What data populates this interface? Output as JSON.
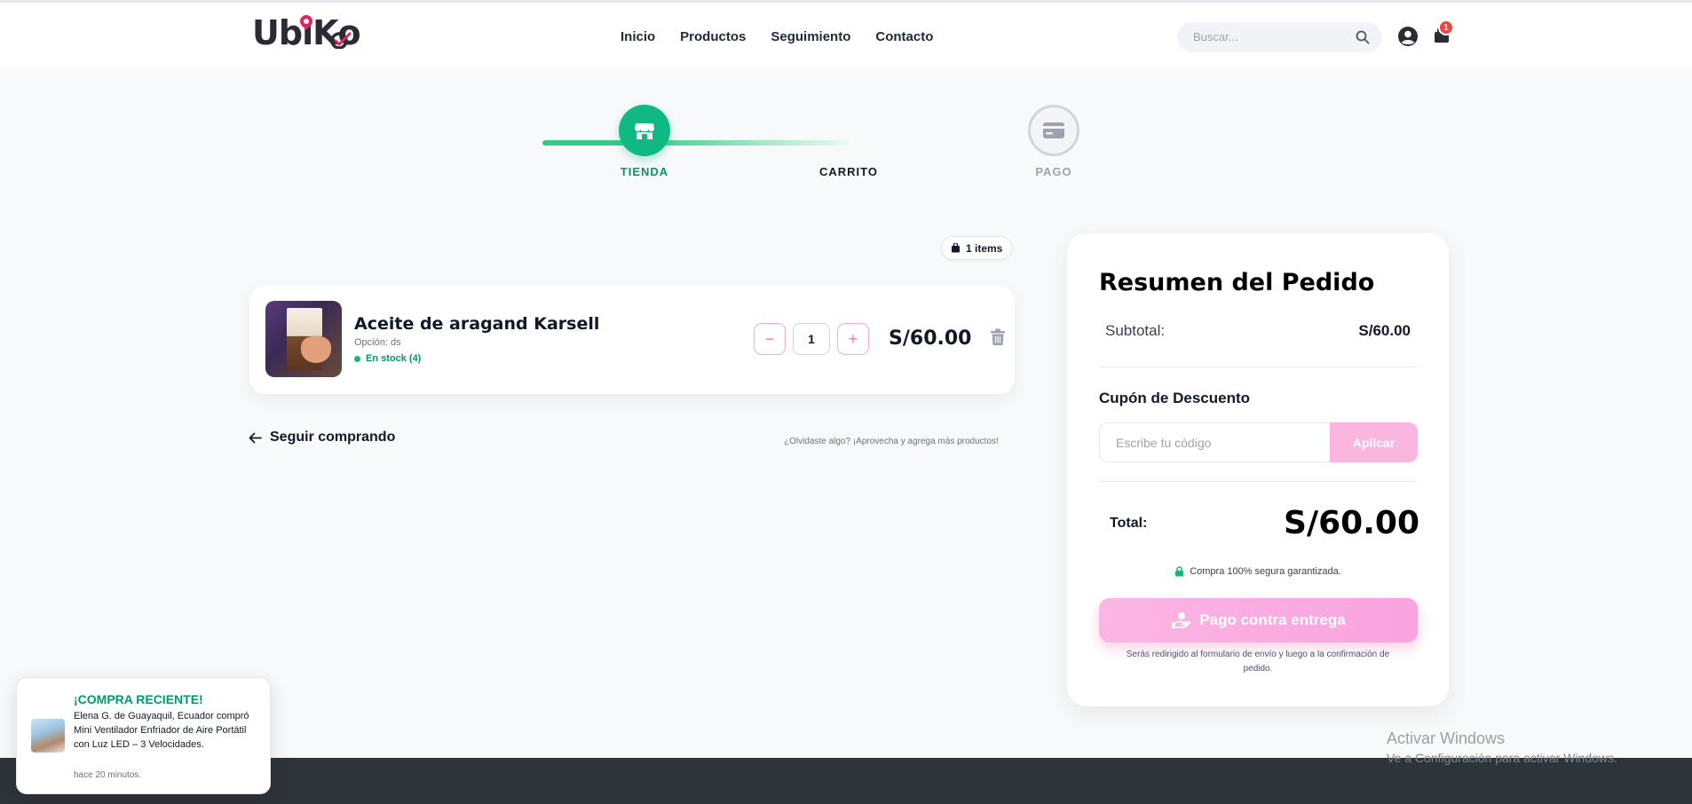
{
  "brand": {
    "logo_text_a": "Ub",
    "logo_text_b": "iK",
    "logo_text_c": "o"
  },
  "nav": {
    "items": [
      {
        "label": "Inicio"
      },
      {
        "label": "Productos"
      },
      {
        "label": "Seguimiento"
      },
      {
        "label": "Contacto"
      }
    ]
  },
  "search": {
    "placeholder": "Buscar..."
  },
  "cart": {
    "badge": "1"
  },
  "steps": [
    {
      "label": "TIENDA",
      "state": "done"
    },
    {
      "label": "CARRITO",
      "state": "current"
    },
    {
      "label": "PAGO",
      "state": "pending"
    }
  ],
  "items_badge": "1 items",
  "product": {
    "name": "Aceite de aragand Karsell",
    "option": "Opción: ds",
    "stock": "En stock (4)",
    "quantity": "1",
    "minus": "−",
    "plus": "+",
    "price": "S/60.00"
  },
  "continue_label": "Seguir comprando",
  "forgot_text": "¿Olvidaste algo? ¡Aprovecha y agrega más productos!",
  "summary": {
    "title": "Resumen del Pedido",
    "subtotal_label": "Subtotal:",
    "subtotal_value": "S/60.00",
    "coupon_title": "Cupón de Descuento",
    "coupon_placeholder": "Escribe tu código",
    "apply_label": "Aplicar",
    "total_label": "Total:",
    "total_value": "S/60.00",
    "secure_text": "Compra 100% segura garantizada.",
    "pay_label": "Pago contra entrega",
    "redirect_text": "Serás redirigido al formulario de envío y luego a la confirmación de pedido."
  },
  "toast": {
    "title": "¡COMPRA RECIENTE!",
    "message": "Elena G. de Guayaquil, Ecuador compró Mini Ventilador Enfriador de Aire Portátil con Luz LED – 3 Velocidades.",
    "time": "hace 20 minutos."
  },
  "windows": {
    "activate": "Activar Windows",
    "sub": "Ve a Configuración para activar Windows."
  },
  "colors": {
    "accent_green": "#10b981",
    "accent_pink": "#f9a3df",
    "badge_red": "#ef4444",
    "footer": "#2f333a"
  }
}
